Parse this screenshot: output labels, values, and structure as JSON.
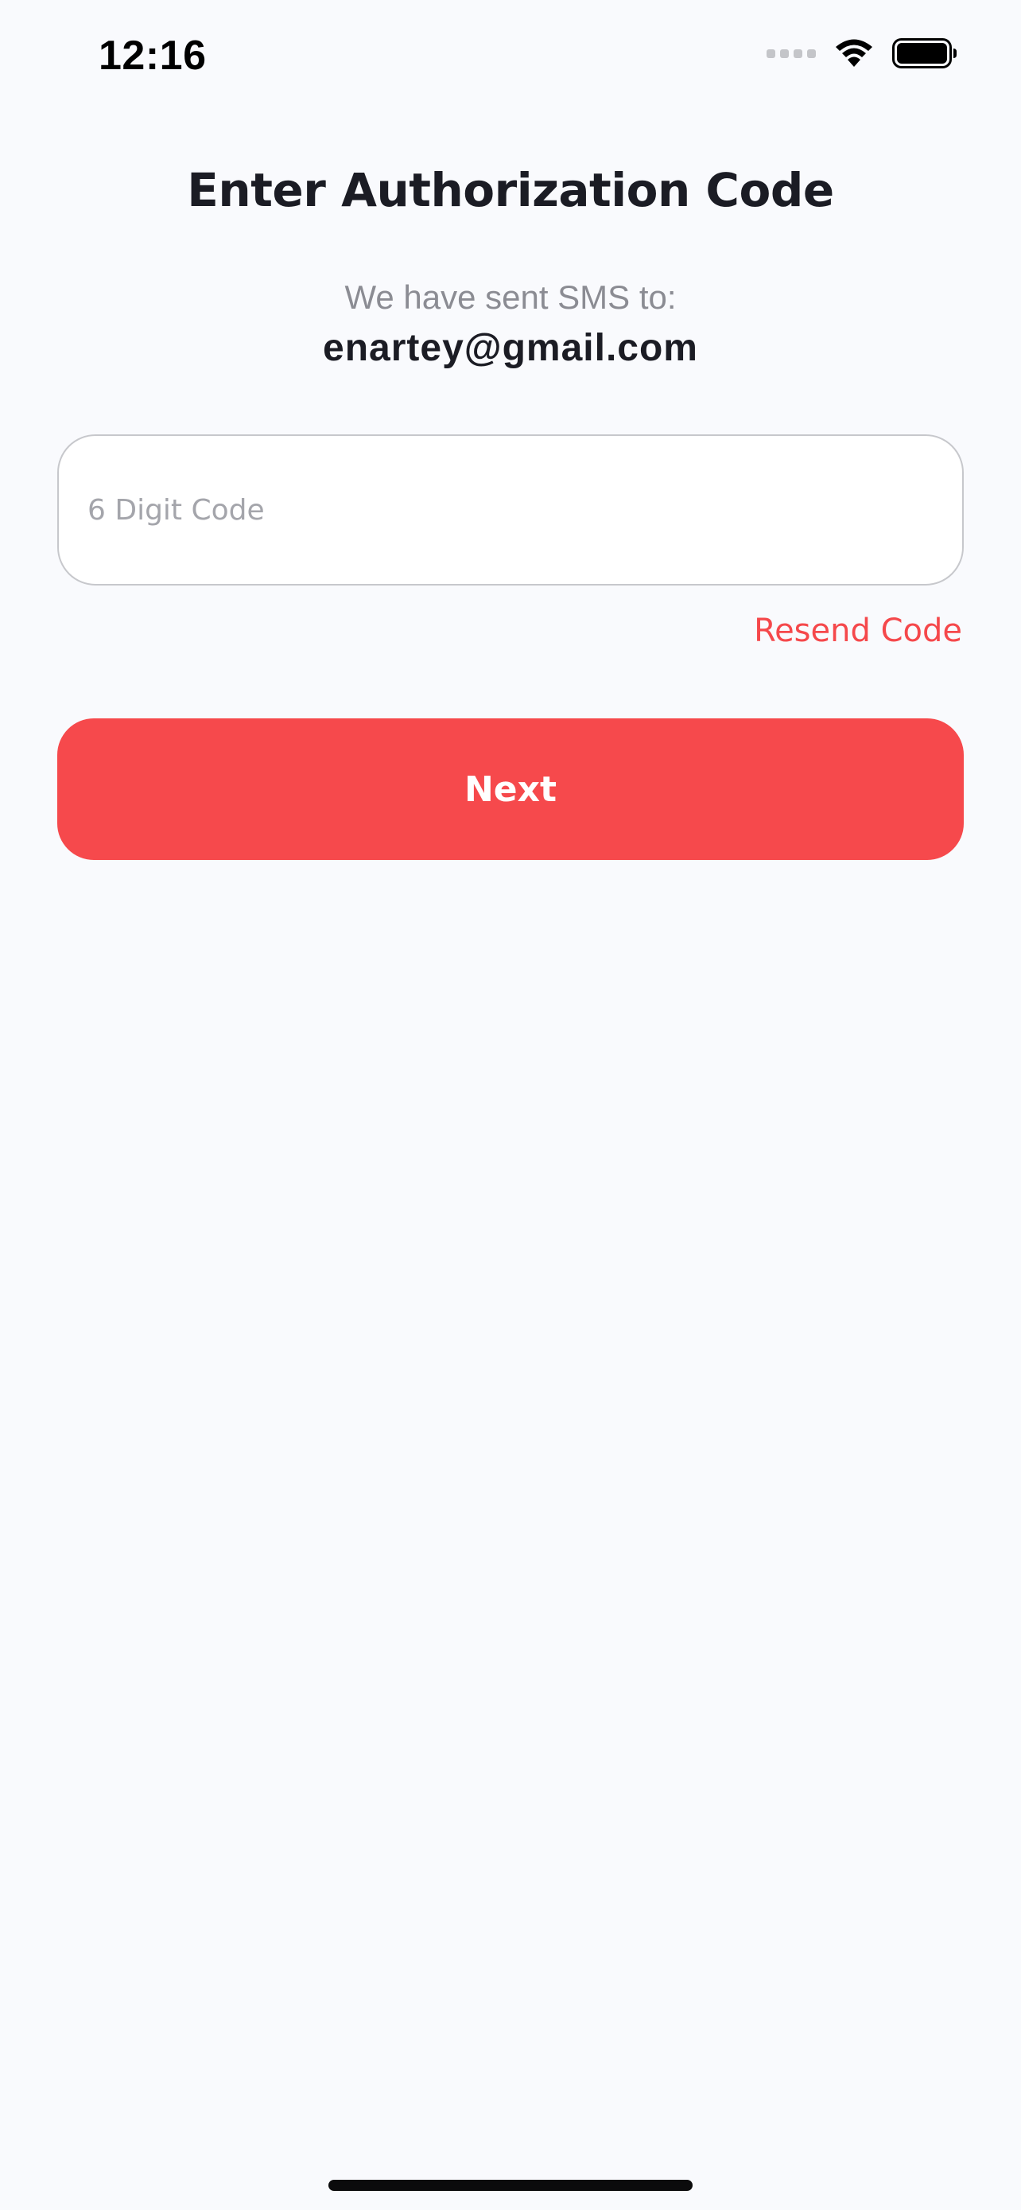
{
  "status_bar": {
    "time": "12:16",
    "icons": [
      "cellular-signal-icon",
      "wifi-icon",
      "battery-icon"
    ]
  },
  "screen": {
    "title": "Enter Authorization Code",
    "subtitle": "We have sent SMS to:",
    "recipient": "enartey@gmail.com"
  },
  "code_input": {
    "value": "",
    "placeholder": "6 Digit Code"
  },
  "resend_label": "Resend Code",
  "next_label": "Next",
  "colors": {
    "accent": "#f6494c",
    "background": "#f9fafd",
    "text_primary": "#1b1c24",
    "text_secondary": "#8b8c93"
  }
}
